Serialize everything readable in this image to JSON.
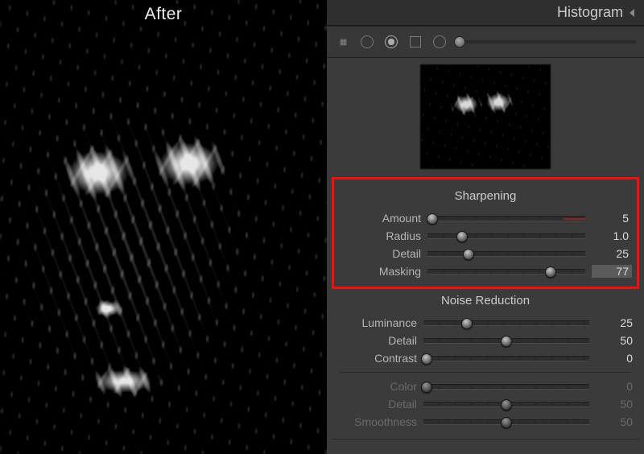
{
  "preview": {
    "mode_label": "After"
  },
  "header": {
    "title": "Histogram"
  },
  "thumb": {},
  "sharpening": {
    "title": "Sharpening",
    "amount": {
      "label": "Amount",
      "value": "5",
      "pct": 3,
      "redtail_pct": 14
    },
    "radius": {
      "label": "Radius",
      "value": "1.0",
      "pct": 22
    },
    "detail": {
      "label": "Detail",
      "value": "25",
      "pct": 26
    },
    "masking": {
      "label": "Masking",
      "value": "77",
      "pct": 78,
      "boxed": true
    }
  },
  "noise": {
    "title": "Noise Reduction",
    "luminance": {
      "label": "Luminance",
      "value": "25",
      "pct": 26
    },
    "detail": {
      "label": "Detail",
      "value": "50",
      "pct": 50
    },
    "contrast": {
      "label": "Contrast",
      "value": "0",
      "pct": 2
    },
    "color": {
      "label": "Color",
      "value": "0",
      "pct": 2
    },
    "cdetail": {
      "label": "Detail",
      "value": "50",
      "pct": 50
    },
    "smoothness": {
      "label": "Smoothness",
      "value": "50",
      "pct": 50
    }
  }
}
